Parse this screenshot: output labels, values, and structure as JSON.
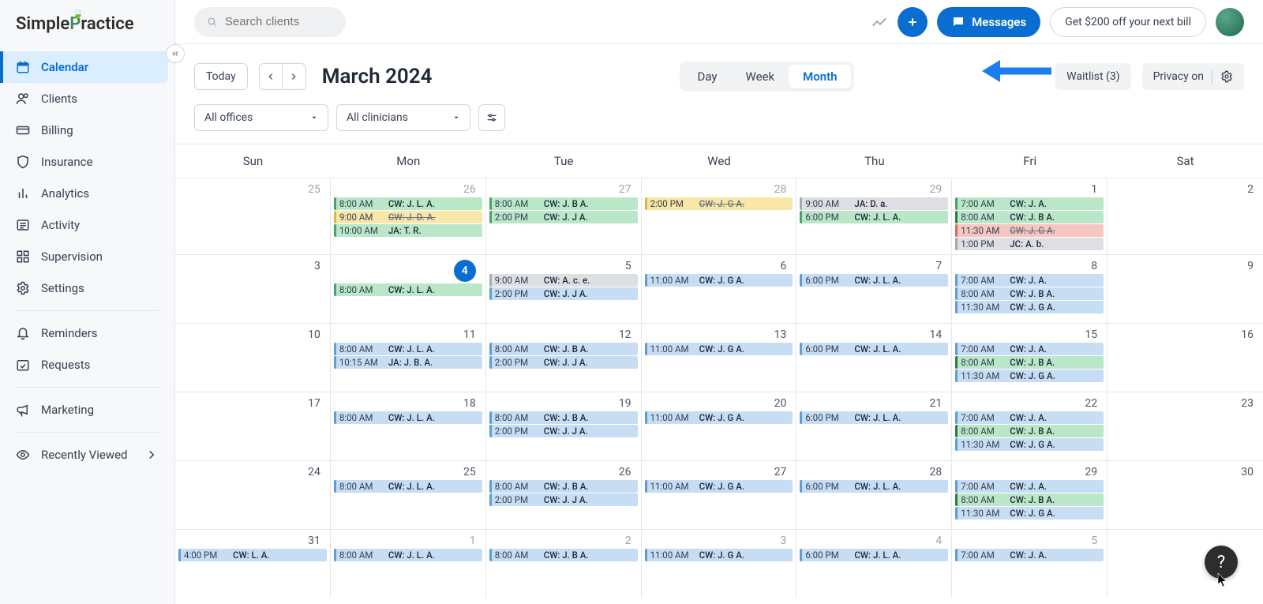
{
  "logo": "SimplePractice",
  "search": {
    "placeholder": "Search clients"
  },
  "header": {
    "messages": "Messages",
    "promo": "Get $200 off your next bill"
  },
  "nav": {
    "calendar": "Calendar",
    "clients": "Clients",
    "billing": "Billing",
    "insurance": "Insurance",
    "analytics": "Analytics",
    "activity": "Activity",
    "supervision": "Supervision",
    "settings": "Settings",
    "reminders": "Reminders",
    "requests": "Requests",
    "marketing": "Marketing",
    "recently": "Recently Viewed"
  },
  "toolbar": {
    "today": "Today",
    "month_label": "March 2024",
    "day": "Day",
    "week": "Week",
    "month": "Month",
    "waitlist": "Waitlist (3)",
    "privacy": "Privacy on"
  },
  "filters": {
    "offices": "All offices",
    "clinicians": "All clinicians"
  },
  "days": [
    "Sun",
    "Mon",
    "Tue",
    "Wed",
    "Thu",
    "Fri",
    "Sat"
  ],
  "weeks": [
    [
      {
        "n": "25",
        "other": true,
        "ev": []
      },
      {
        "n": "26",
        "other": true,
        "ev": [
          {
            "t": "8:00 AM",
            "x": "CW: J. L. A.",
            "c": "green"
          },
          {
            "t": "9:00 AM",
            "x": "CW: J. D. A.",
            "c": "yellow",
            "s": true
          },
          {
            "t": "10:00 AM",
            "x": "JA: T. R.",
            "c": "green"
          }
        ]
      },
      {
        "n": "27",
        "other": true,
        "ev": [
          {
            "t": "8:00 AM",
            "x": "CW: J. B A.",
            "c": "green"
          },
          {
            "t": "2:00 PM",
            "x": "CW: J. J A.",
            "c": "green"
          }
        ]
      },
      {
        "n": "28",
        "other": true,
        "ev": [
          {
            "t": "2:00 PM",
            "x": "CW: J. G A.",
            "c": "yellow",
            "s": true
          }
        ]
      },
      {
        "n": "29",
        "other": true,
        "ev": [
          {
            "t": "9:00 AM",
            "x": "JA: D. a.",
            "c": "grey"
          },
          {
            "t": "6:00 PM",
            "x": "CW: J. L. A.",
            "c": "green"
          }
        ]
      },
      {
        "n": "1",
        "ev": [
          {
            "t": "7:00 AM",
            "x": "CW: J. A.",
            "c": "green"
          },
          {
            "t": "8:00 AM",
            "x": "CW: J. B A.",
            "c": "green-d"
          },
          {
            "t": "11:30 AM",
            "x": "CW: J. G A.",
            "c": "red",
            "s": true
          },
          {
            "t": "1:00 PM",
            "x": "JC: A. b.",
            "c": "grey"
          }
        ]
      },
      {
        "n": "2",
        "ev": []
      }
    ],
    [
      {
        "n": "3",
        "ev": []
      },
      {
        "n": "4",
        "today": true,
        "ev": [
          {
            "t": "8:00 AM",
            "x": "CW: J. L. A.",
            "c": "green"
          }
        ]
      },
      {
        "n": "5",
        "ev": [
          {
            "t": "9:00 AM",
            "x": "CW: A. c. e.",
            "c": "grey"
          },
          {
            "t": "2:00 PM",
            "x": "CW: J. J A.",
            "c": "blue"
          }
        ]
      },
      {
        "n": "6",
        "ev": [
          {
            "t": "11:00 AM",
            "x": "CW: J. G A.",
            "c": "blue"
          }
        ]
      },
      {
        "n": "7",
        "ev": [
          {
            "t": "6:00 PM",
            "x": "CW: J. L. A.",
            "c": "blue"
          }
        ]
      },
      {
        "n": "8",
        "ev": [
          {
            "t": "7:00 AM",
            "x": "CW: J. A.",
            "c": "blue"
          },
          {
            "t": "8:00 AM",
            "x": "CW: J. B A.",
            "c": "blue"
          },
          {
            "t": "11:30 AM",
            "x": "CW: J. G A.",
            "c": "blue"
          }
        ]
      },
      {
        "n": "9",
        "ev": []
      }
    ],
    [
      {
        "n": "10",
        "ev": []
      },
      {
        "n": "11",
        "ev": [
          {
            "t": "8:00 AM",
            "x": "CW: J. L. A.",
            "c": "blue"
          },
          {
            "t": "10:15 AM",
            "x": "JA: J. B. A.",
            "c": "blue"
          }
        ]
      },
      {
        "n": "12",
        "ev": [
          {
            "t": "8:00 AM",
            "x": "CW: J. B A.",
            "c": "blue"
          },
          {
            "t": "2:00 PM",
            "x": "CW: J. J A.",
            "c": "blue"
          }
        ]
      },
      {
        "n": "13",
        "ev": [
          {
            "t": "11:00 AM",
            "x": "CW: J. G A.",
            "c": "blue"
          }
        ]
      },
      {
        "n": "14",
        "ev": [
          {
            "t": "6:00 PM",
            "x": "CW: J. L. A.",
            "c": "blue"
          }
        ]
      },
      {
        "n": "15",
        "ev": [
          {
            "t": "7:00 AM",
            "x": "CW: J. A.",
            "c": "blue"
          },
          {
            "t": "8:00 AM",
            "x": "CW: J. B A.",
            "c": "green-d"
          },
          {
            "t": "11:30 AM",
            "x": "CW: J. G A.",
            "c": "blue"
          }
        ]
      },
      {
        "n": "16",
        "ev": []
      }
    ],
    [
      {
        "n": "17",
        "ev": []
      },
      {
        "n": "18",
        "ev": [
          {
            "t": "8:00 AM",
            "x": "CW: J. L. A.",
            "c": "blue"
          }
        ]
      },
      {
        "n": "19",
        "ev": [
          {
            "t": "8:00 AM",
            "x": "CW: J. B A.",
            "c": "blue"
          },
          {
            "t": "2:00 PM",
            "x": "CW: J. J A.",
            "c": "blue"
          }
        ]
      },
      {
        "n": "20",
        "ev": [
          {
            "t": "11:00 AM",
            "x": "CW: J. G A.",
            "c": "blue"
          }
        ]
      },
      {
        "n": "21",
        "ev": [
          {
            "t": "6:00 PM",
            "x": "CW: J. L. A.",
            "c": "blue"
          }
        ]
      },
      {
        "n": "22",
        "ev": [
          {
            "t": "7:00 AM",
            "x": "CW: J. A.",
            "c": "blue"
          },
          {
            "t": "8:00 AM",
            "x": "CW: J. B A.",
            "c": "green-d"
          },
          {
            "t": "11:30 AM",
            "x": "CW: J. G A.",
            "c": "blue"
          }
        ]
      },
      {
        "n": "23",
        "ev": []
      }
    ],
    [
      {
        "n": "24",
        "ev": []
      },
      {
        "n": "25",
        "ev": [
          {
            "t": "8:00 AM",
            "x": "CW: J. L. A.",
            "c": "blue"
          }
        ]
      },
      {
        "n": "26",
        "ev": [
          {
            "t": "8:00 AM",
            "x": "CW: J. B A.",
            "c": "blue"
          },
          {
            "t": "2:00 PM",
            "x": "CW: J. J A.",
            "c": "blue"
          }
        ]
      },
      {
        "n": "27",
        "ev": [
          {
            "t": "11:00 AM",
            "x": "CW: J. G A.",
            "c": "blue"
          }
        ]
      },
      {
        "n": "28",
        "ev": [
          {
            "t": "6:00 PM",
            "x": "CW: J. L. A.",
            "c": "blue"
          }
        ]
      },
      {
        "n": "29",
        "ev": [
          {
            "t": "7:00 AM",
            "x": "CW: J. A.",
            "c": "blue"
          },
          {
            "t": "8:00 AM",
            "x": "CW: J. B A.",
            "c": "green-d"
          },
          {
            "t": "11:30 AM",
            "x": "CW: J. G A.",
            "c": "blue"
          }
        ]
      },
      {
        "n": "30",
        "ev": []
      }
    ],
    [
      {
        "n": "31",
        "ev": [
          {
            "t": "4:00 PM",
            "x": "CW: L. A.",
            "c": "blue"
          }
        ]
      },
      {
        "n": "1",
        "other": true,
        "ev": [
          {
            "t": "8:00 AM",
            "x": "CW: J. L. A.",
            "c": "blue"
          }
        ]
      },
      {
        "n": "2",
        "other": true,
        "ev": [
          {
            "t": "8:00 AM",
            "x": "CW: J. B A.",
            "c": "blue"
          }
        ]
      },
      {
        "n": "3",
        "other": true,
        "ev": [
          {
            "t": "11:00 AM",
            "x": "CW: J. G A.",
            "c": "blue"
          }
        ]
      },
      {
        "n": "4",
        "other": true,
        "ev": [
          {
            "t": "6:00 PM",
            "x": "CW: J. L. A.",
            "c": "blue"
          }
        ]
      },
      {
        "n": "5",
        "other": true,
        "ev": [
          {
            "t": "7:00 AM",
            "x": "CW: J. A.",
            "c": "blue"
          }
        ]
      },
      {
        "n": "",
        "other": true,
        "ev": []
      }
    ]
  ]
}
